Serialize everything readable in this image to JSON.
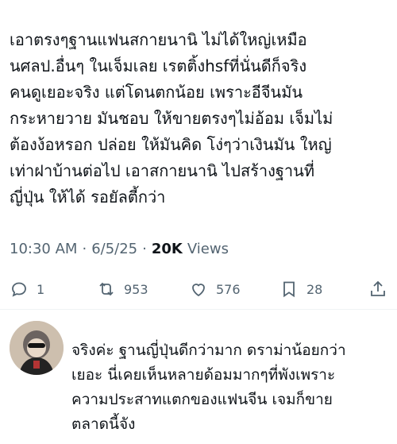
{
  "tweet": {
    "text_lines": [
      "เอาตรงๆฐานแฟนสกายนานิ ไม่ได้ใหญ่เหมือ",
      "นศลป.อื่นๆ ในเจ็มเลย เรตติ้งhsfที่นั่นดีก็จริง",
      "คนดูเยอะจริง แต่โดนตกน้อย เพราะอีจีนมัน",
      "กระหายวาย มันชอบ ให้ขายตรงๆไม่อ้อม เจ็มไม่",
      "ต้องง้อหรอก ปล่อย ให้มันคิด โง่ๆว่าเงินมัน ใหญ่",
      "เท่าฝาบ้านต่อไป เอาสกายนานิ ไปสร้างฐานที่",
      "ญี่ปุ่น ให้ได้ รอยัลตี้กว่า"
    ],
    "time": "10:30 AM",
    "separator": "·",
    "date": "6/5/25",
    "views_count": "20K",
    "views_label": "Views"
  },
  "actions": {
    "reply_count": "1",
    "retweet_count": "953",
    "like_count": "576",
    "bookmark_count": "28"
  },
  "reply": {
    "text_lines": [
      "จริงค่ะ ฐานญี่ปุ่นดีกว่ามาก ดราม่าน้อยกว่า",
      "เยอะ นี่เคยเห็นหลายด้อมมากๆที่พังเพราะ",
      "ความประสาทแตกของแฟนจีน เจมก็ขาย",
      "ตลาดนี้จัง"
    ]
  }
}
